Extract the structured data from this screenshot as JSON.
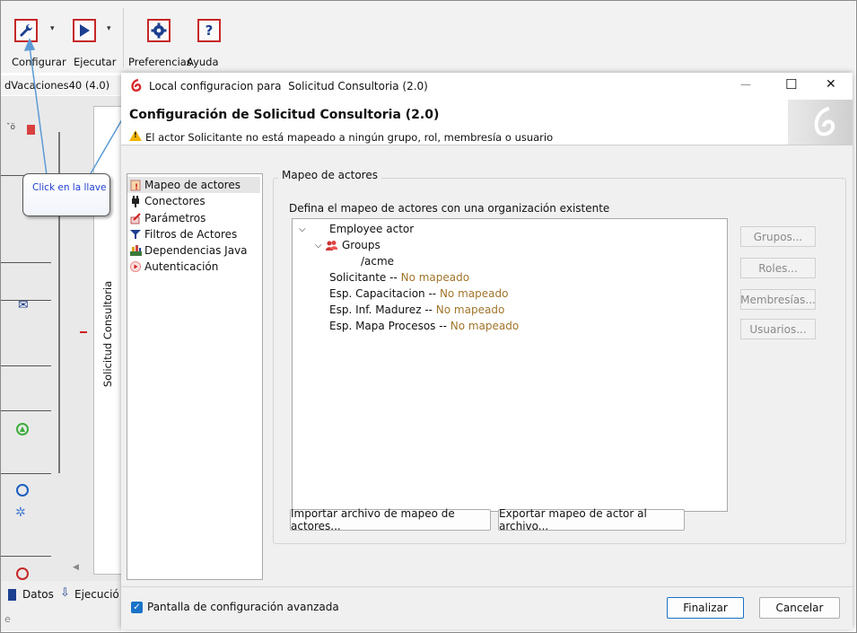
{
  "toolbar": {
    "configurar_label": "Configurar",
    "ejecutar_label": "Ejecutar",
    "preferencias_label": "Preferencias",
    "ayuda_label": "Ayuda",
    "dropdown_arrow": "▾"
  },
  "background": {
    "tab_label": "dVacaciones40 (4.0)",
    "vertical_pool_label": "Solicitud Consultoria",
    "bottom_tab_datos": "Datos",
    "bottom_tab_ejecucion": "Ejecució"
  },
  "callout": {
    "text": "Click en la llave"
  },
  "dialog": {
    "title": "Local configuracion para  Solicitud Consultoria (2.0)",
    "minimize": "—",
    "maximize": "☐",
    "close": "✕",
    "header_title": "Configuración de Solicitud Consultoria (2.0)",
    "warning": "El actor Solicitante no está mapeado a ningún grupo, rol, membresía o usuario",
    "nav": [
      {
        "label": "Mapeo de actores",
        "icon": "actor-mapping-warning-icon"
      },
      {
        "label": "Conectores",
        "icon": "connector-plug-icon"
      },
      {
        "label": "Parámetros",
        "icon": "parameters-icon"
      },
      {
        "label": "Filtros de Actores",
        "icon": "filter-icon"
      },
      {
        "label": "Dependencias Java",
        "icon": "java-dependencies-icon"
      },
      {
        "label": "Autenticación",
        "icon": "authentication-icon"
      }
    ],
    "panel": {
      "group_title": "Mapeo de actores",
      "instruction": "Defina el mapeo de actores con una organización existente",
      "tree": {
        "employee_actor": "Employee actor",
        "groups": "Groups",
        "acme": "/acme",
        "actors": [
          {
            "name": "Solicitante",
            "sep": " -- ",
            "status": "No mapeado"
          },
          {
            "name": "Esp. Capacitacion",
            "sep": " -- ",
            "status": "No mapeado"
          },
          {
            "name": "Esp. Inf. Madurez",
            "sep": " -- ",
            "status": "No mapeado"
          },
          {
            "name": "Esp. Mapa Procesos",
            "sep": " -- ",
            "status": "No mapeado"
          }
        ]
      },
      "side_buttons": [
        "Grupos...",
        "Roles...",
        "Membresías...",
        "Usuarios..."
      ],
      "import_button": "Importar archivo de mapeo de actores...",
      "export_button": "Exportar mapeo de actor al archivo..."
    },
    "footer": {
      "advanced_checkbox_label": "Pantalla de configuración avanzada",
      "advanced_checked": true,
      "finish_button": "Finalizar",
      "cancel_button": "Cancelar"
    }
  },
  "colors": {
    "accent_red": "#c62828",
    "not_mapped": "#a0752a",
    "annotation_arrow": "#5b9bd5",
    "callout_text": "#1f3fd0"
  }
}
